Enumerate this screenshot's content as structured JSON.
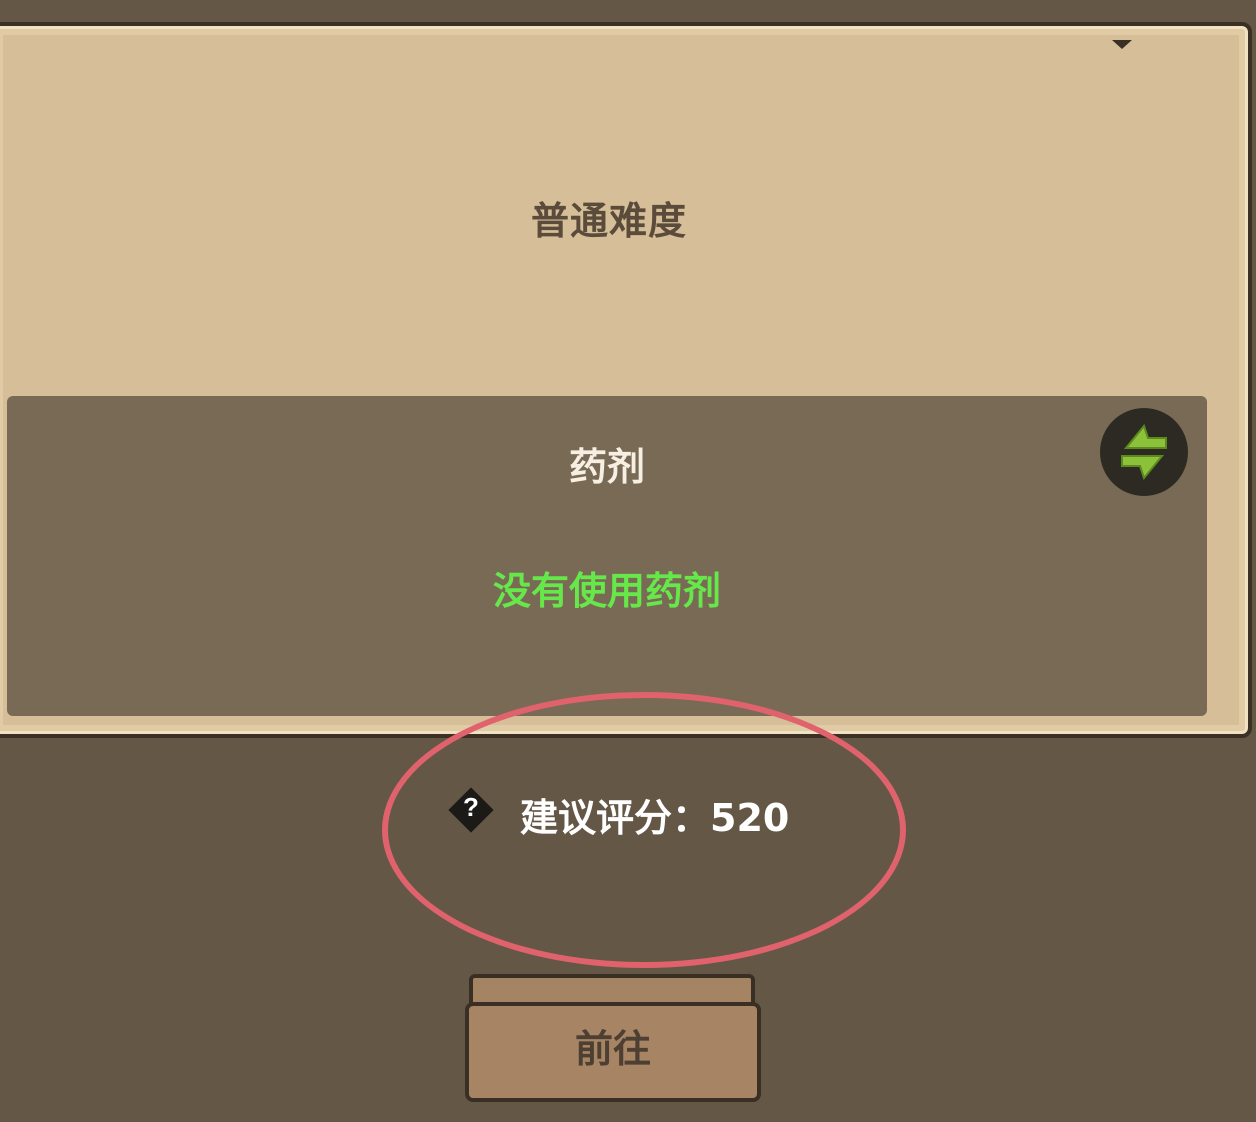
{
  "difficulty": {
    "title": "普通难度"
  },
  "potion": {
    "title": "药剂",
    "status": "没有使用药剂",
    "status_color": "#67e84a",
    "swap_icon": "swap-arrows-icon"
  },
  "score": {
    "help_icon": "question-icon",
    "help_symbol": "?",
    "label": "建议评分：520"
  },
  "go_button": {
    "label": "前往"
  },
  "colors": {
    "background": "#645746",
    "panel": "#d6bf98",
    "potion_box": "#786a55",
    "highlight": "#e0626c"
  }
}
